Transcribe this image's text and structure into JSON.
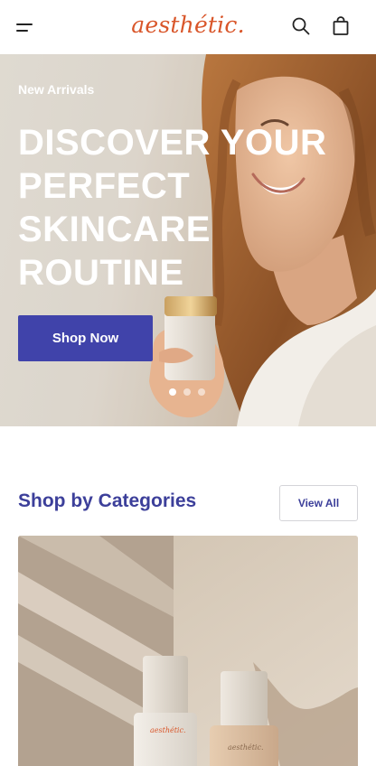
{
  "header": {
    "logo": "aesthétic.",
    "menu_icon": "menu-icon",
    "search_icon": "search-icon",
    "bag_icon": "shopping-bag-icon"
  },
  "hero": {
    "eyebrow": "New Arrivals",
    "title": "DISCOVER YOUR PERFECT SKINCARE ROUTINE",
    "cta_label": "Shop Now",
    "slides_count": 3,
    "active_slide": 1
  },
  "categories": {
    "title": "Shop by Categories",
    "view_all_label": "View All",
    "card_bottle_brand_1": "aesthétic.",
    "card_bottle_brand_2": "aesthétic."
  },
  "colors": {
    "brand": "#d9562a",
    "primary": "#4043aa",
    "heading": "#3c3f9a"
  }
}
